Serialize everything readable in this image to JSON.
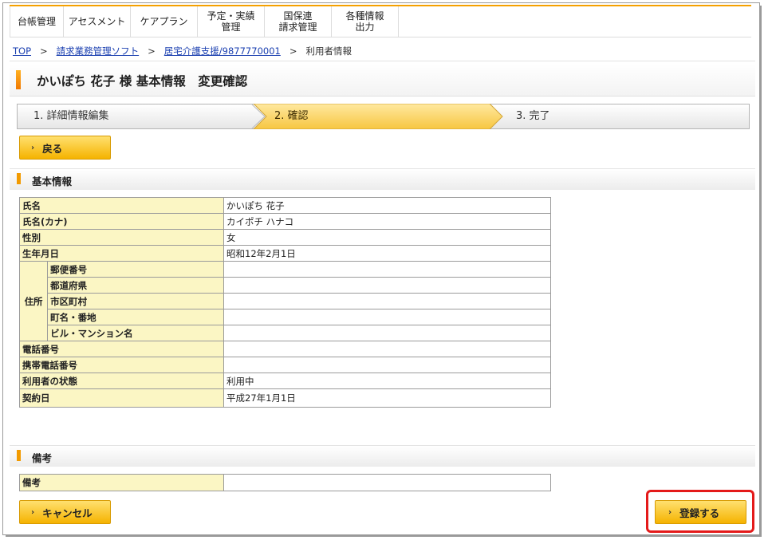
{
  "nav": {
    "tabs": [
      {
        "label": "台帳管理"
      },
      {
        "label": "アセスメント"
      },
      {
        "label": "ケアプラン"
      },
      {
        "label": "予定・実績\n管理"
      },
      {
        "label": "国保連\n請求管理"
      },
      {
        "label": "各種情報\n出力"
      }
    ]
  },
  "breadcrumb": {
    "top": "TOP",
    "soft": "請求業務管理ソフト",
    "service": "居宅介護支援/9877770001",
    "current": "利用者情報",
    "separator": ">"
  },
  "page": {
    "title": "かいぽち 花子 様 基本情報　変更確認"
  },
  "steps": {
    "step1": "1. 詳細情報編集",
    "step2": "2. 確認",
    "step3": "3. 完了",
    "active": 2
  },
  "buttons": {
    "back": "戻る",
    "cancel": "キャンセル",
    "register": "登録する"
  },
  "sections": {
    "basic": "基本情報",
    "notes": "備考"
  },
  "basic_info": {
    "name_label": "氏名",
    "name_value": "かいぽち 花子",
    "kana_label": "氏名(カナ)",
    "kana_value": "カイポチ ハナコ",
    "gender_label": "性別",
    "gender_value": "女",
    "birth_label": "生年月日",
    "birth_value": "昭和12年2月1日",
    "address_label": "住所",
    "postal_label": "郵便番号",
    "postal_value": "",
    "pref_label": "都道府県",
    "pref_value": "",
    "city_label": "市区町村",
    "city_value": "",
    "town_label": "町名・番地",
    "town_value": "",
    "building_label": "ビル・マンション名",
    "building_value": "",
    "phone_label": "電話番号",
    "phone_value": "",
    "mobile_label": "携帯電話番号",
    "mobile_value": "",
    "status_label": "利用者の状態",
    "status_value": "利用中",
    "contract_label": "契約日",
    "contract_value": "平成27年1月1日"
  },
  "notes_table": {
    "label": "備考",
    "value": ""
  },
  "colors": {
    "accent": "#f5a000",
    "table_header_bg": "#fbf6c4",
    "button_bg": "#f5b300",
    "highlight": "#e41a1a"
  }
}
